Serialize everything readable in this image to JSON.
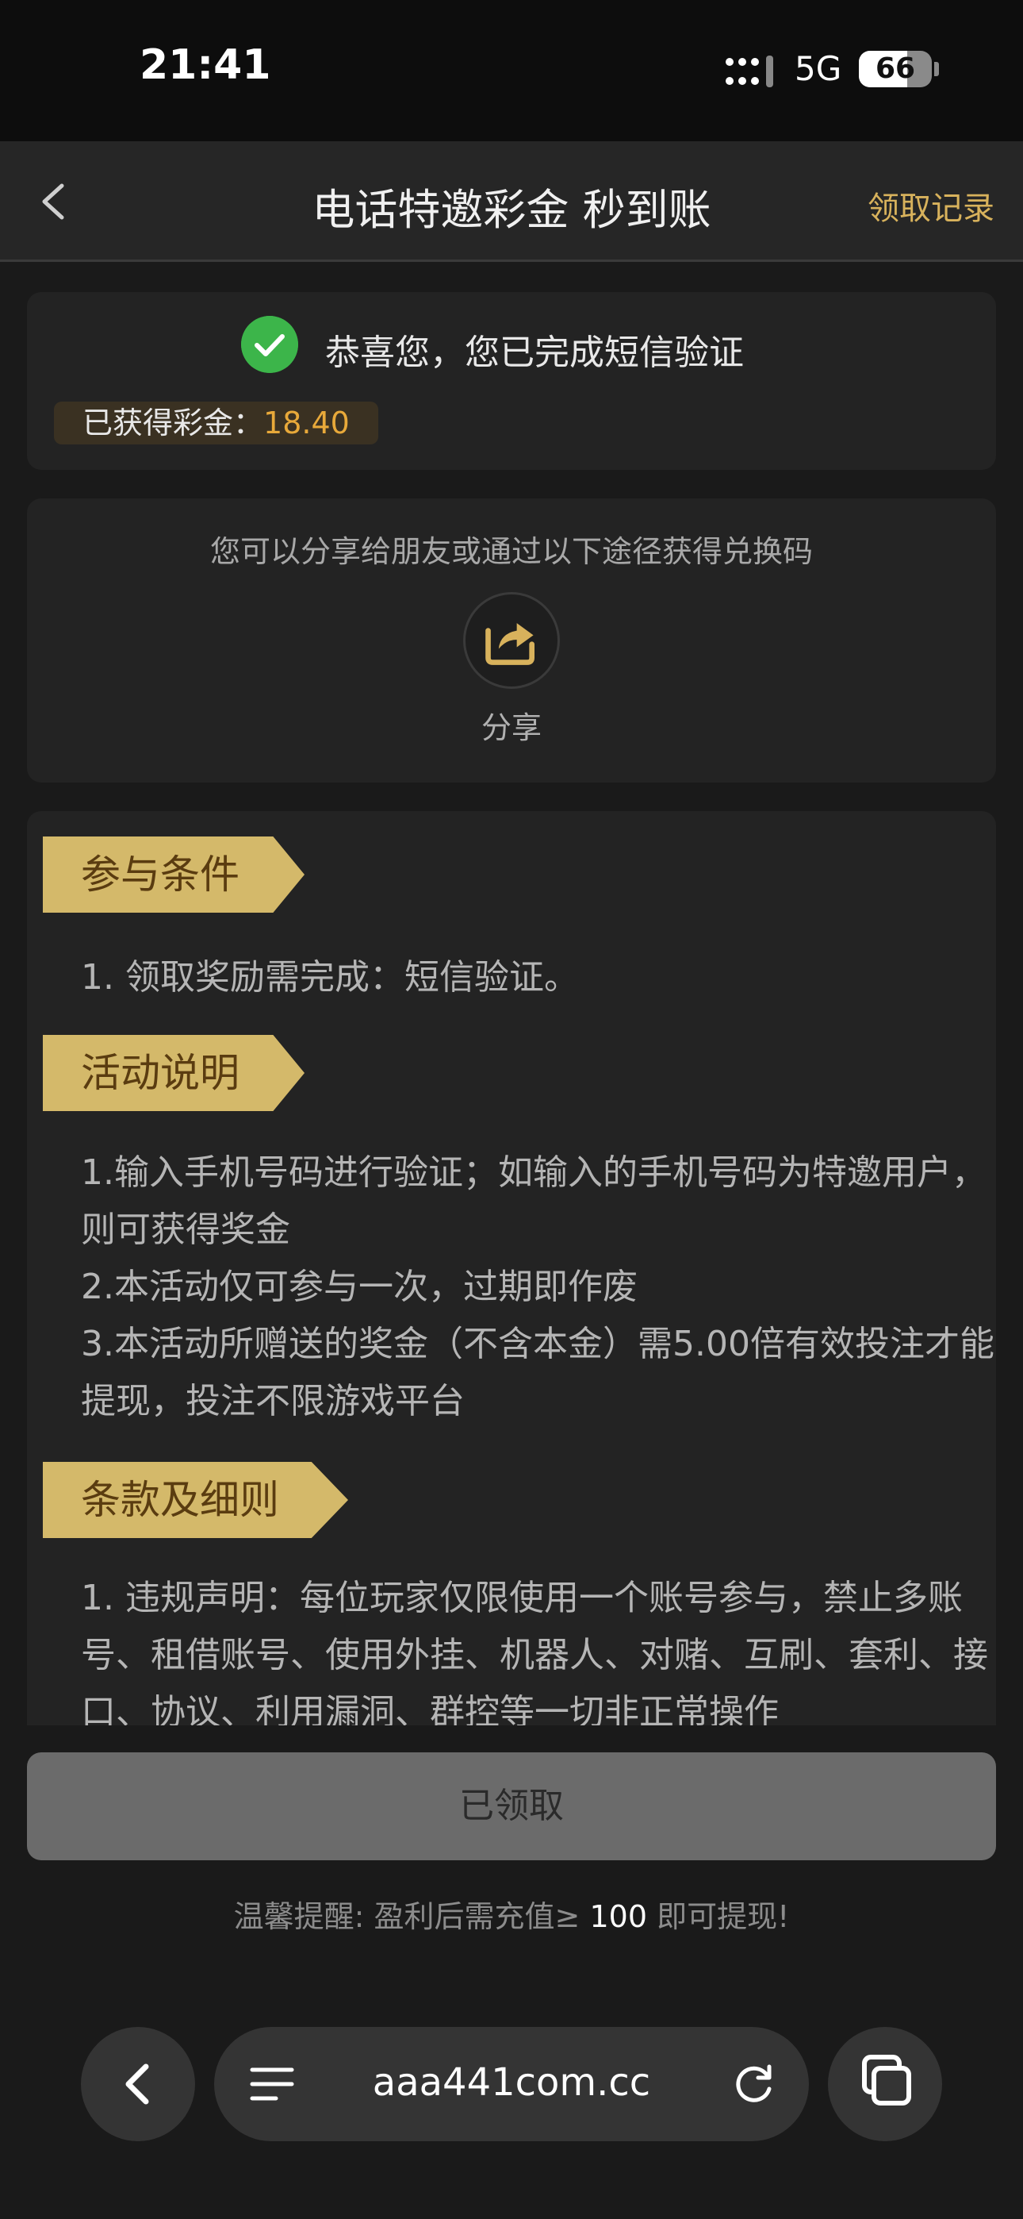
{
  "status_bar": {
    "time": "21:41",
    "network": "5G",
    "battery": "66",
    "battery_level_percent": 66
  },
  "nav": {
    "back_icon": "chevron-left-icon",
    "title": "电话特邀彩金 秒到账",
    "records_label": "领取记录"
  },
  "verify_card": {
    "icon": "check-circle-icon",
    "message": "恭喜您，您已完成短信验证",
    "earned_label": "已获得彩金：",
    "earned_value": "18.40"
  },
  "share_card": {
    "hint": "您可以分享给朋友或通过以下途径获得兑换码",
    "icon": "share-icon",
    "label": "分享"
  },
  "rules": {
    "conditions_title": "参与条件",
    "conditions_lines": [
      "1. 领取奖励需完成：短信验证。"
    ],
    "activity_title": "活动说明",
    "activity_lines": [
      "1.输入手机号码进行验证；如输入的手机号码为特邀用户，则可获得奖金",
      "2.本活动仅可参与一次，过期即作废",
      "3.本活动所赠送的奖金（不含本金）需5.00倍有效投注才能提现，投注不限游戏平台"
    ],
    "terms_title": "条款及细则",
    "terms_lines": [
      "1. 违规声明：每位玩家仅限使用一个账号参与，禁止多账号、租借账号、使用外挂、机器人、对赌、互刷、套利、接口、协议、利用漏洞、群控等一切非正常操作"
    ]
  },
  "bottom": {
    "claimed_button": "已领取",
    "reminder_prefix": "温馨提醒: 盈利后需充值≥",
    "reminder_amount": "100",
    "reminder_suffix": "即可提现!"
  },
  "browser": {
    "url": "aaa441com.cc",
    "back_icon": "chevron-left-icon",
    "menu_icon": "menu-lines-icon",
    "reload_icon": "reload-icon",
    "tabs_icon": "tabs-icon"
  },
  "colors": {
    "accent_gold": "#d8b25c",
    "earned_orange": "#e8a93a",
    "ribbon_gold": "#d4b96a",
    "success_green": "#3cb54a"
  }
}
